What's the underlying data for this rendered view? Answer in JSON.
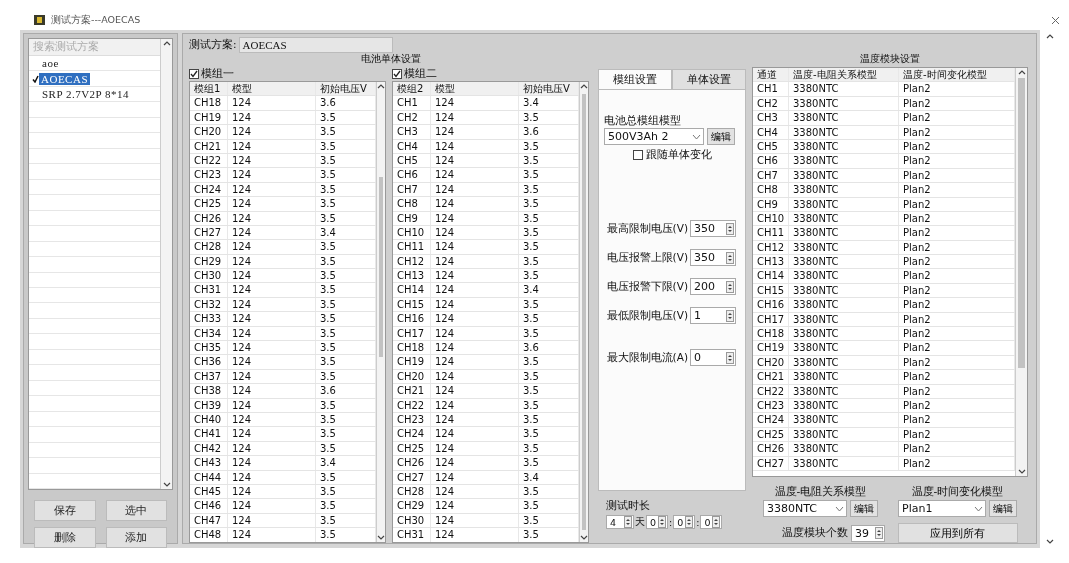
{
  "window": {
    "title": "测试方案---AOECAS"
  },
  "plans": {
    "search": {
      "placeholder": "搜索测试方案"
    },
    "items": [
      {
        "label": "aoe",
        "selected": false
      },
      {
        "label": "AOECAS",
        "selected": true
      },
      {
        "label": "SRP 2.7V2P 8*14",
        "selected": false
      }
    ],
    "buttons": [
      "保存",
      "选中",
      "删除",
      "添加"
    ]
  },
  "plan_name": {
    "label": "测试方案:",
    "value": "AOECAS"
  },
  "cell_settings": {
    "title": "电池单体设置",
    "modules": [
      {
        "label": "模组一",
        "checked": true,
        "columns": [
          "模组1",
          "模型",
          "初始电压V"
        ],
        "rows": [
          [
            "CH18",
            "124",
            "3.6"
          ],
          [
            "CH19",
            "124",
            "3.5"
          ],
          [
            "CH20",
            "124",
            "3.5"
          ],
          [
            "CH21",
            "124",
            "3.5"
          ],
          [
            "CH22",
            "124",
            "3.5"
          ],
          [
            "CH23",
            "124",
            "3.5"
          ],
          [
            "CH24",
            "124",
            "3.5"
          ],
          [
            "CH25",
            "124",
            "3.5"
          ],
          [
            "CH26",
            "124",
            "3.5"
          ],
          [
            "CH27",
            "124",
            "3.4"
          ],
          [
            "CH28",
            "124",
            "3.5"
          ],
          [
            "CH29",
            "124",
            "3.5"
          ],
          [
            "CH30",
            "124",
            "3.5"
          ],
          [
            "CH31",
            "124",
            "3.5"
          ],
          [
            "CH32",
            "124",
            "3.5"
          ],
          [
            "CH33",
            "124",
            "3.5"
          ],
          [
            "CH34",
            "124",
            "3.5"
          ],
          [
            "CH35",
            "124",
            "3.5"
          ],
          [
            "CH36",
            "124",
            "3.5"
          ],
          [
            "CH37",
            "124",
            "3.5"
          ],
          [
            "CH38",
            "124",
            "3.6"
          ],
          [
            "CH39",
            "124",
            "3.5"
          ],
          [
            "CH40",
            "124",
            "3.5"
          ],
          [
            "CH41",
            "124",
            "3.5"
          ],
          [
            "CH42",
            "124",
            "3.5"
          ],
          [
            "CH43",
            "124",
            "3.4"
          ],
          [
            "CH44",
            "124",
            "3.5"
          ],
          [
            "CH45",
            "124",
            "3.5"
          ],
          [
            "CH46",
            "124",
            "3.5"
          ],
          [
            "CH47",
            "124",
            "3.5"
          ],
          [
            "CH48",
            "124",
            "3.5"
          ]
        ]
      },
      {
        "label": "模组二",
        "checked": true,
        "columns": [
          "模组2",
          "模型",
          "初始电压V"
        ],
        "rows": [
          [
            "CH1",
            "124",
            "3.4"
          ],
          [
            "CH2",
            "124",
            "3.5"
          ],
          [
            "CH3",
            "124",
            "3.6"
          ],
          [
            "CH4",
            "124",
            "3.5"
          ],
          [
            "CH5",
            "124",
            "3.5"
          ],
          [
            "CH6",
            "124",
            "3.5"
          ],
          [
            "CH7",
            "124",
            "3.5"
          ],
          [
            "CH8",
            "124",
            "3.5"
          ],
          [
            "CH9",
            "124",
            "3.5"
          ],
          [
            "CH10",
            "124",
            "3.5"
          ],
          [
            "CH11",
            "124",
            "3.5"
          ],
          [
            "CH12",
            "124",
            "3.5"
          ],
          [
            "CH13",
            "124",
            "3.5"
          ],
          [
            "CH14",
            "124",
            "3.4"
          ],
          [
            "CH15",
            "124",
            "3.5"
          ],
          [
            "CH16",
            "124",
            "3.5"
          ],
          [
            "CH17",
            "124",
            "3.5"
          ],
          [
            "CH18",
            "124",
            "3.6"
          ],
          [
            "CH19",
            "124",
            "3.5"
          ],
          [
            "CH20",
            "124",
            "3.5"
          ],
          [
            "CH21",
            "124",
            "3.5"
          ],
          [
            "CH22",
            "124",
            "3.5"
          ],
          [
            "CH23",
            "124",
            "3.5"
          ],
          [
            "CH24",
            "124",
            "3.5"
          ],
          [
            "CH25",
            "124",
            "3.5"
          ],
          [
            "CH26",
            "124",
            "3.5"
          ],
          [
            "CH27",
            "124",
            "3.4"
          ],
          [
            "CH28",
            "124",
            "3.5"
          ],
          [
            "CH29",
            "124",
            "3.5"
          ],
          [
            "CH30",
            "124",
            "3.5"
          ],
          [
            "CH31",
            "124",
            "3.5"
          ]
        ]
      }
    ]
  },
  "module_settings": {
    "tabs": [
      {
        "label": "模组设置",
        "selected": true
      },
      {
        "label": "单体设置",
        "selected": false
      }
    ],
    "model": {
      "label": "电池总模组模型",
      "value": "500V3Ah 2",
      "button": "编辑"
    },
    "follow": {
      "label": "跟随单体变化",
      "checked": false
    },
    "limits": [
      {
        "label": "最高限制电压(V)",
        "value": "350"
      },
      {
        "label": "电压报警上限(V)",
        "value": "350"
      },
      {
        "label": "电压报警下限(V)",
        "value": "200"
      },
      {
        "label": "最低限制电压(V)",
        "value": "1"
      },
      {
        "label": "最大限制电流(A)",
        "value": "0"
      }
    ]
  },
  "test_duration": {
    "label": "测试时长",
    "fields": [
      {
        "value": "4",
        "suffix": "天"
      },
      {
        "value": "0",
        "suffix": ":"
      },
      {
        "value": "0",
        "suffix": ":"
      },
      {
        "value": "0"
      }
    ]
  },
  "temperature": {
    "title": "温度模块设置",
    "columns": [
      "通道",
      "温度-电阻关系模型",
      "温度-时间变化模型"
    ],
    "rows": [
      [
        "CH1",
        "3380NTC",
        "Plan2"
      ],
      [
        "CH2",
        "3380NTC",
        "Plan2"
      ],
      [
        "CH3",
        "3380NTC",
        "Plan2"
      ],
      [
        "CH4",
        "3380NTC",
        "Plan2"
      ],
      [
        "CH5",
        "3380NTC",
        "Plan2"
      ],
      [
        "CH6",
        "3380NTC",
        "Plan2"
      ],
      [
        "CH7",
        "3380NTC",
        "Plan2"
      ],
      [
        "CH8",
        "3380NTC",
        "Plan2"
      ],
      [
        "CH9",
        "3380NTC",
        "Plan2"
      ],
      [
        "CH10",
        "3380NTC",
        "Plan2"
      ],
      [
        "CH11",
        "3380NTC",
        "Plan2"
      ],
      [
        "CH12",
        "3380NTC",
        "Plan2"
      ],
      [
        "CH13",
        "3380NTC",
        "Plan2"
      ],
      [
        "CH14",
        "3380NTC",
        "Plan2"
      ],
      [
        "CH15",
        "3380NTC",
        "Plan2"
      ],
      [
        "CH16",
        "3380NTC",
        "Plan2"
      ],
      [
        "CH17",
        "3380NTC",
        "Plan2"
      ],
      [
        "CH18",
        "3380NTC",
        "Plan2"
      ],
      [
        "CH19",
        "3380NTC",
        "Plan2"
      ],
      [
        "CH20",
        "3380NTC",
        "Plan2"
      ],
      [
        "CH21",
        "3380NTC",
        "Plan2"
      ],
      [
        "CH22",
        "3380NTC",
        "Plan2"
      ],
      [
        "CH23",
        "3380NTC",
        "Plan2"
      ],
      [
        "CH24",
        "3380NTC",
        "Plan2"
      ],
      [
        "CH25",
        "3380NTC",
        "Plan2"
      ],
      [
        "CH26",
        "3380NTC",
        "Plan2"
      ],
      [
        "CH27",
        "3380NTC",
        "Plan2"
      ]
    ],
    "resistance_model": {
      "label": "温度-电阻关系模型",
      "value": "3380NTC",
      "button": "编辑"
    },
    "time_model": {
      "label": "温度-时间变化模型",
      "value": "Plan1",
      "button": "编辑"
    },
    "count": {
      "label": "温度模块个数",
      "value": "39"
    },
    "apply_button": "应用到所有"
  }
}
